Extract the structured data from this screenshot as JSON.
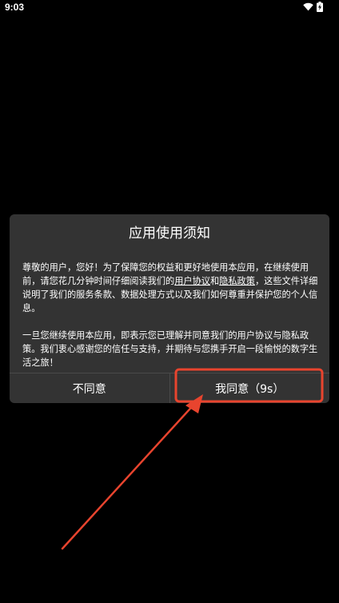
{
  "status_bar": {
    "time": "9:03",
    "icons": [
      "wifi-icon",
      "battery-charging-icon"
    ]
  },
  "dialog": {
    "title": "应用使用须知",
    "paragraph1": {
      "part1": "尊敬的用户，您好！为了保障您的权益和更好地使用本应用，在继续使用前，请您花几分钟时间仔细阅读我们的",
      "link_user_agreement": "用户协议",
      "and": "和",
      "link_privacy_policy": "隐私政策",
      "part2": "，这些文件详细说明了我们的服务条款、数据处理方式以及我们如何尊重并保护您的个人信息。"
    },
    "paragraph2": "一旦您继续使用本应用，即表示您已理解并同意我们的用户协议与隐私政策。我们衷心感谢您的信任与支持，并期待与您携手开启一段愉悦的数字生活之旅！",
    "buttons": {
      "disagree": "不同意",
      "agree": "我同意（9s）"
    }
  },
  "colors": {
    "background": "#000000",
    "dialog_bg": "#333333",
    "annotation": "#e8442e"
  }
}
